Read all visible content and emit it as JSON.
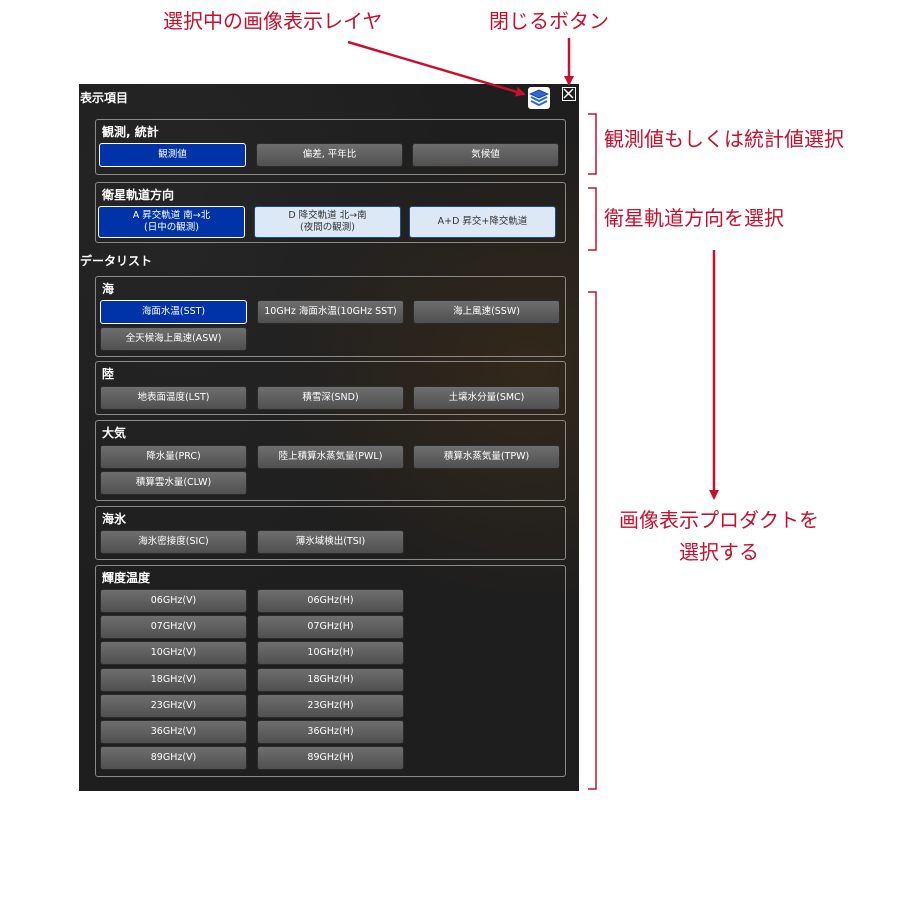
{
  "annotations": {
    "selected_layer": "選択中の画像表示レイヤ",
    "close_button": "閉じるボタン",
    "obs_stat": "観測値もしくは統計値選択",
    "orbit": "衛星軌道方向を選択",
    "product_line1": "画像表示プロダクトを",
    "product_line2": "選択する"
  },
  "colors": {
    "annotation": "#c8102e",
    "selected": "#0033a8",
    "panel": "#1e1e1e"
  },
  "panel": {
    "title": "表示項目",
    "layer_icon": "layers-icon",
    "close_icon": "close-icon",
    "data_list_title": "データリスト"
  },
  "display": {
    "mode": {
      "title": "観測, 統計",
      "buttons": [
        "観測値",
        "偏差, 平年比",
        "気候値"
      ]
    },
    "orbit": {
      "title": "衛星軌道方向",
      "a_line1": "A 昇交軌道 南→北",
      "a_line2": "(日中の観測)",
      "d_line1": "D 降交軌道 北→南",
      "d_line2": "(夜間の観測)",
      "ad": "A+D 昇交+降交軌道"
    }
  },
  "datalist": {
    "sea": {
      "title": "海",
      "items": [
        "海面水温(SST)",
        "10GHz 海面水温(10GHz SST)",
        "海上風速(SSW)",
        "全天候海上風速(ASW)"
      ]
    },
    "land": {
      "title": "陸",
      "items": [
        "地表面温度(LST)",
        "積雪深(SND)",
        "土壌水分量(SMC)"
      ]
    },
    "atmosphere": {
      "title": "大気",
      "items": [
        "降水量(PRC)",
        "陸上積算水蒸気量(PWL)",
        "積算水蒸気量(TPW)",
        "積算雲水量(CLW)"
      ]
    },
    "sea_ice": {
      "title": "海氷",
      "items": [
        "海氷密接度(SIC)",
        "薄氷域検出(TSI)"
      ]
    },
    "brightness": {
      "title": "輝度温度",
      "v": [
        "06GHz(V)",
        "07GHz(V)",
        "10GHz(V)",
        "18GHz(V)",
        "23GHz(V)",
        "36GHz(V)",
        "89GHz(V)"
      ],
      "h": [
        "06GHz(H)",
        "07GHz(H)",
        "10GHz(H)",
        "18GHz(H)",
        "23GHz(H)",
        "36GHz(H)",
        "89GHz(H)"
      ]
    }
  }
}
